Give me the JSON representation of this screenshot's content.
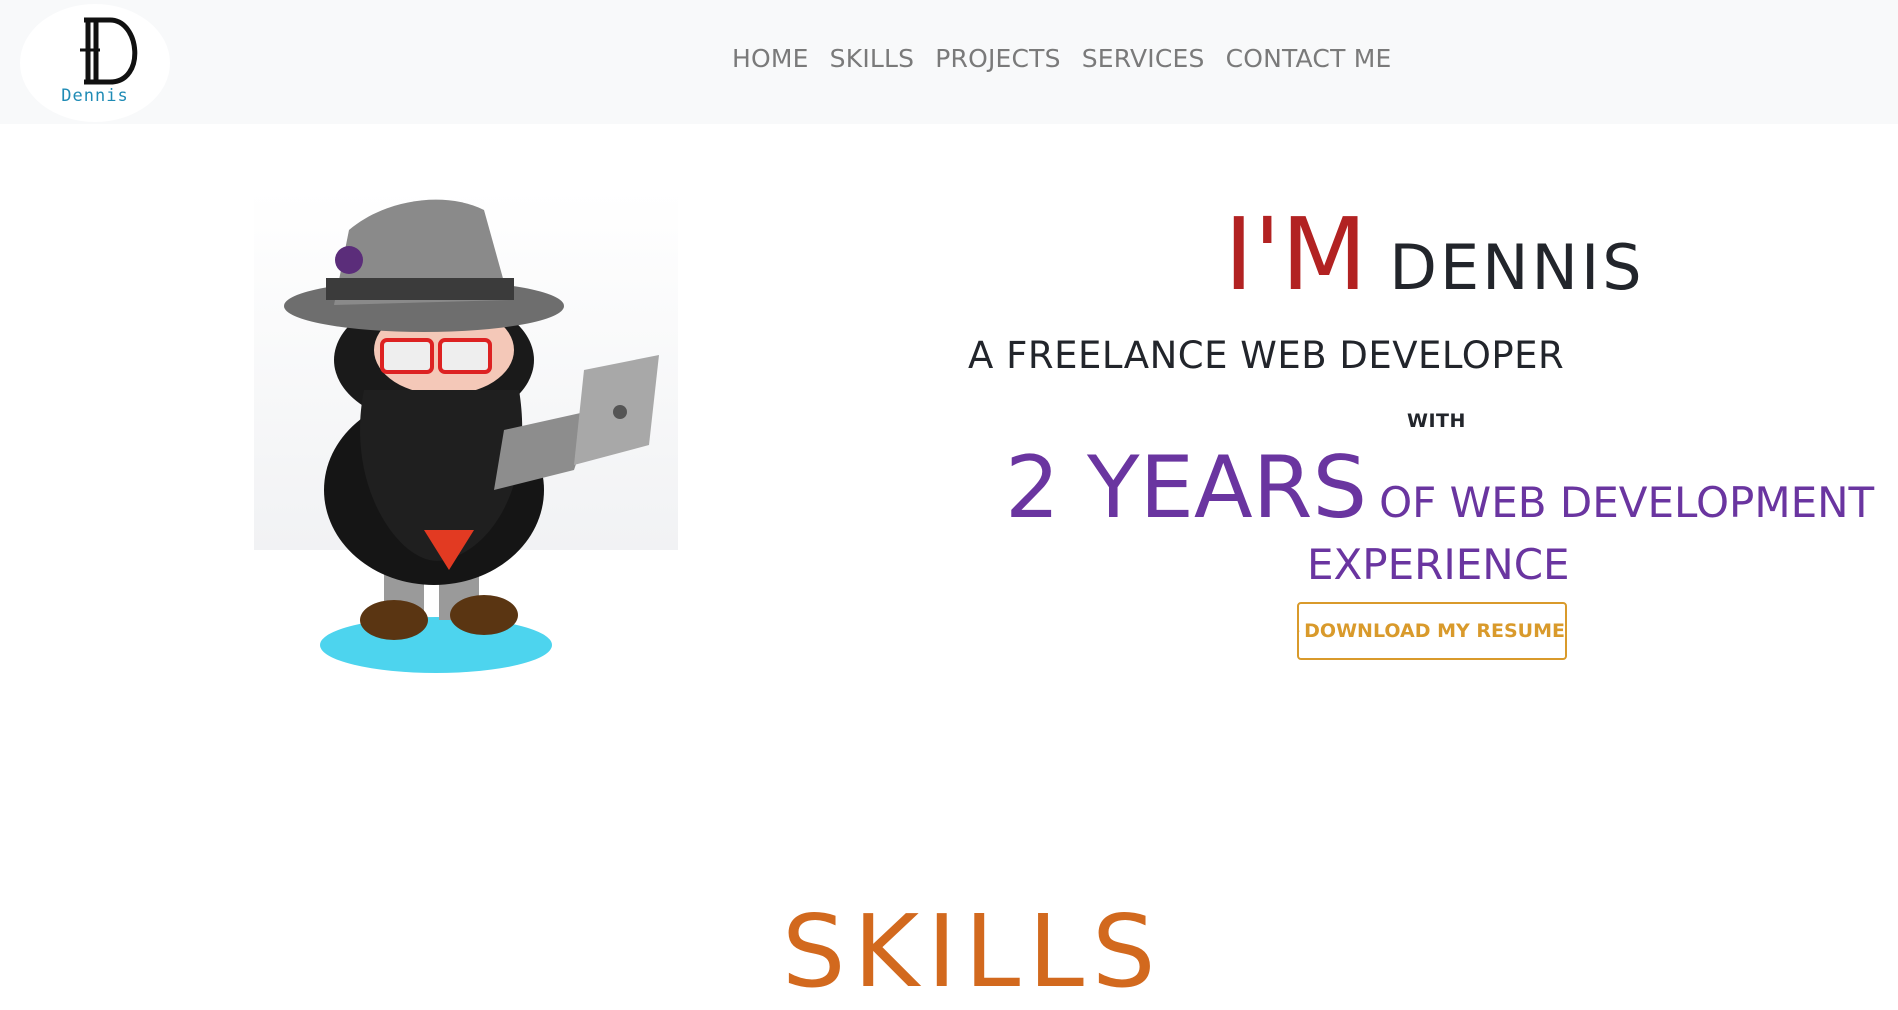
{
  "brand": {
    "logo_text": "Dennis"
  },
  "nav": {
    "items": [
      "HOME",
      "SKILLS",
      "PROJECTS",
      "SERVICES",
      "CONTACT ME"
    ]
  },
  "hero": {
    "greeting": "I'M",
    "name": "DENNIS",
    "role": "A FREELANCE WEB DEVELOPER",
    "with": "WITH",
    "years": "2 YEARS",
    "years_rest": "OF WEB DEVELOPMENT",
    "experience": "EXPERIENCE",
    "resume_button": "DOWNLOAD MY RESUME",
    "image_icon": "octocat-developer-illustration"
  },
  "skills": {
    "heading": "SKILLS"
  },
  "colors": {
    "navbar_bg": "#f8f9fa",
    "greeting": "#b22222",
    "years": "#6a35a0",
    "resume": "#d99a2b",
    "skills": "#d2691e"
  }
}
